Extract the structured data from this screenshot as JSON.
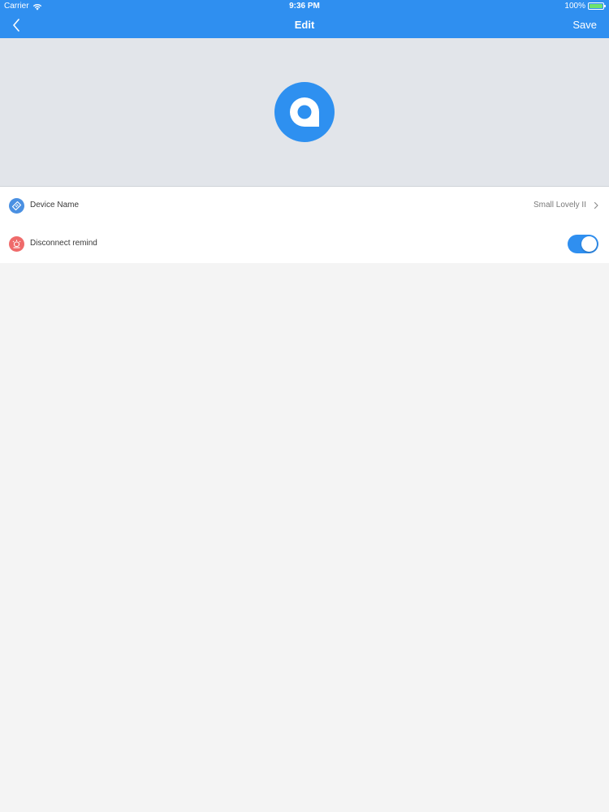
{
  "status_bar": {
    "carrier": "Carrier",
    "time": "9:36 PM",
    "battery_percent": "100%",
    "battery_level": 1.0,
    "wifi_icon": "wifi-icon",
    "battery_icon": "battery-icon"
  },
  "nav": {
    "title": "Edit",
    "save_label": "Save",
    "back_icon": "chevron-left-icon"
  },
  "device": {
    "avatar_icon": "device-tag-icon",
    "avatar_color": "#2e90f0"
  },
  "settings": {
    "items": [
      {
        "label": "Device Name",
        "value": "Small Lovely II",
        "icon": "tag-icon",
        "icon_color": "#4a90e2"
      },
      {
        "label": "Disconnect remind",
        "icon": "alarm-icon",
        "icon_color": "#ef6b6b",
        "toggle_on": true
      }
    ]
  },
  "colors": {
    "accent": "#2f8ff0",
    "header_bg": "#e2e5ea",
    "page_bg": "#f4f4f4"
  }
}
